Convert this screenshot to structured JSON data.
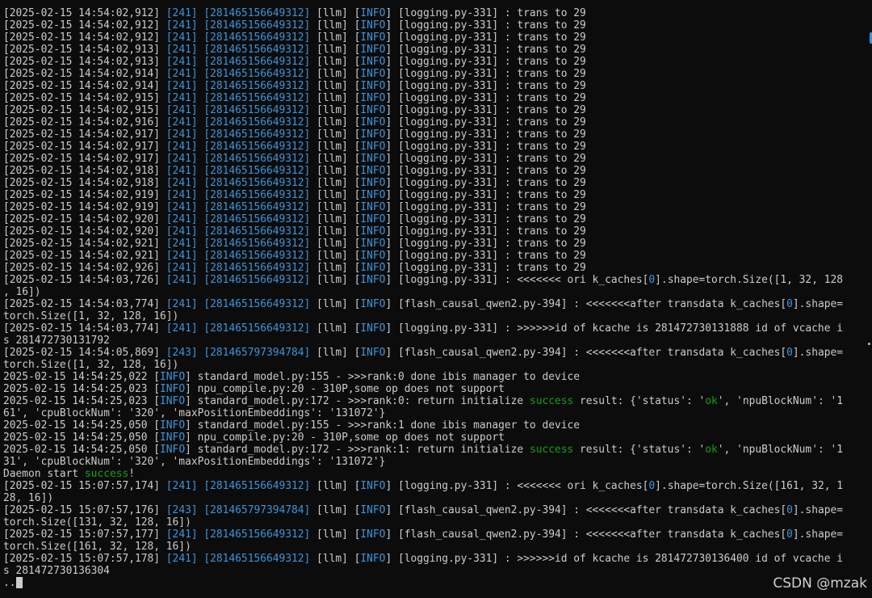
{
  "terminal": {
    "lines": [
      [
        [
          "[2025-02-15 14:54:02,912] ",
          "w"
        ],
        [
          "[241] [281465156649312]",
          "c"
        ],
        [
          " [llm] [",
          "w"
        ],
        [
          "INFO",
          "c"
        ],
        [
          "] [logging.py-331] : trans to 29",
          "w"
        ]
      ],
      [
        [
          "[2025-02-15 14:54:02,912] ",
          "w"
        ],
        [
          "[241] [281465156649312]",
          "c"
        ],
        [
          " [llm] [",
          "w"
        ],
        [
          "INFO",
          "c"
        ],
        [
          "] [logging.py-331] : trans to 29",
          "w"
        ]
      ],
      [
        [
          "[2025-02-15 14:54:02,912] ",
          "w"
        ],
        [
          "[241] [281465156649312]",
          "c"
        ],
        [
          " [llm] [",
          "w"
        ],
        [
          "INFO",
          "c"
        ],
        [
          "] [logging.py-331] : trans to 29",
          "w"
        ]
      ],
      [
        [
          "[2025-02-15 14:54:02,913] ",
          "w"
        ],
        [
          "[241] [281465156649312]",
          "c"
        ],
        [
          " [llm] [",
          "w"
        ],
        [
          "INFO",
          "c"
        ],
        [
          "] [logging.py-331] : trans to 29",
          "w"
        ]
      ],
      [
        [
          "[2025-02-15 14:54:02,913] ",
          "w"
        ],
        [
          "[241] [281465156649312]",
          "c"
        ],
        [
          " [llm] [",
          "w"
        ],
        [
          "INFO",
          "c"
        ],
        [
          "] [logging.py-331] : trans to 29",
          "w"
        ]
      ],
      [
        [
          "[2025-02-15 14:54:02,914] ",
          "w"
        ],
        [
          "[241] [281465156649312]",
          "c"
        ],
        [
          " [llm] [",
          "w"
        ],
        [
          "INFO",
          "c"
        ],
        [
          "] [logging.py-331] : trans to 29",
          "w"
        ]
      ],
      [
        [
          "[2025-02-15 14:54:02,914] ",
          "w"
        ],
        [
          "[241] [281465156649312]",
          "c"
        ],
        [
          " [llm] [",
          "w"
        ],
        [
          "INFO",
          "c"
        ],
        [
          "] [logging.py-331] : trans to 29",
          "w"
        ]
      ],
      [
        [
          "[2025-02-15 14:54:02,915] ",
          "w"
        ],
        [
          "[241] [281465156649312]",
          "c"
        ],
        [
          " [llm] [",
          "w"
        ],
        [
          "INFO",
          "c"
        ],
        [
          "] [logging.py-331] : trans to 29",
          "w"
        ]
      ],
      [
        [
          "[2025-02-15 14:54:02,915] ",
          "w"
        ],
        [
          "[241] [281465156649312]",
          "c"
        ],
        [
          " [llm] [",
          "w"
        ],
        [
          "INFO",
          "c"
        ],
        [
          "] [logging.py-331] : trans to 29",
          "w"
        ]
      ],
      [
        [
          "[2025-02-15 14:54:02,916] ",
          "w"
        ],
        [
          "[241] [281465156649312]",
          "c"
        ],
        [
          " [llm] [",
          "w"
        ],
        [
          "INFO",
          "c"
        ],
        [
          "] [logging.py-331] : trans to 29",
          "w"
        ]
      ],
      [
        [
          "[2025-02-15 14:54:02,917] ",
          "w"
        ],
        [
          "[241] [281465156649312]",
          "c"
        ],
        [
          " [llm] [",
          "w"
        ],
        [
          "INFO",
          "c"
        ],
        [
          "] [logging.py-331] : trans to 29",
          "w"
        ]
      ],
      [
        [
          "[2025-02-15 14:54:02,917] ",
          "w"
        ],
        [
          "[241] [281465156649312]",
          "c"
        ],
        [
          " [llm] [",
          "w"
        ],
        [
          "INFO",
          "c"
        ],
        [
          "] [logging.py-331] : trans to 29",
          "w"
        ]
      ],
      [
        [
          "[2025-02-15 14:54:02,917] ",
          "w"
        ],
        [
          "[241] [281465156649312]",
          "c"
        ],
        [
          " [llm] [",
          "w"
        ],
        [
          "INFO",
          "c"
        ],
        [
          "] [logging.py-331] : trans to 29",
          "w"
        ]
      ],
      [
        [
          "[2025-02-15 14:54:02,918] ",
          "w"
        ],
        [
          "[241] [281465156649312]",
          "c"
        ],
        [
          " [llm] [",
          "w"
        ],
        [
          "INFO",
          "c"
        ],
        [
          "] [logging.py-331] : trans to 29",
          "w"
        ]
      ],
      [
        [
          "[2025-02-15 14:54:02,918] ",
          "w"
        ],
        [
          "[241] [281465156649312]",
          "c"
        ],
        [
          " [llm] [",
          "w"
        ],
        [
          "INFO",
          "c"
        ],
        [
          "] [logging.py-331] : trans to 29",
          "w"
        ]
      ],
      [
        [
          "[2025-02-15 14:54:02,919] ",
          "w"
        ],
        [
          "[241] [281465156649312]",
          "c"
        ],
        [
          " [llm] [",
          "w"
        ],
        [
          "INFO",
          "c"
        ],
        [
          "] [logging.py-331] : trans to 29",
          "w"
        ]
      ],
      [
        [
          "[2025-02-15 14:54:02,919] ",
          "w"
        ],
        [
          "[241] [281465156649312]",
          "c"
        ],
        [
          " [llm] [",
          "w"
        ],
        [
          "INFO",
          "c"
        ],
        [
          "] [logging.py-331] : trans to 29",
          "w"
        ]
      ],
      [
        [
          "[2025-02-15 14:54:02,920] ",
          "w"
        ],
        [
          "[241] [281465156649312]",
          "c"
        ],
        [
          " [llm] [",
          "w"
        ],
        [
          "INFO",
          "c"
        ],
        [
          "] [logging.py-331] : trans to 29",
          "w"
        ]
      ],
      [
        [
          "[2025-02-15 14:54:02,920] ",
          "w"
        ],
        [
          "[241] [281465156649312]",
          "c"
        ],
        [
          " [llm] [",
          "w"
        ],
        [
          "INFO",
          "c"
        ],
        [
          "] [logging.py-331] : trans to 29",
          "w"
        ]
      ],
      [
        [
          "[2025-02-15 14:54:02,921] ",
          "w"
        ],
        [
          "[241] [281465156649312]",
          "c"
        ],
        [
          " [llm] [",
          "w"
        ],
        [
          "INFO",
          "c"
        ],
        [
          "] [logging.py-331] : trans to 29",
          "w"
        ]
      ],
      [
        [
          "[2025-02-15 14:54:02,921] ",
          "w"
        ],
        [
          "[241] [281465156649312]",
          "c"
        ],
        [
          " [llm] [",
          "w"
        ],
        [
          "INFO",
          "c"
        ],
        [
          "] [logging.py-331] : trans to 29",
          "w"
        ]
      ],
      [
        [
          "[2025-02-15 14:54:02,926] ",
          "w"
        ],
        [
          "[241] [281465156649312]",
          "c"
        ],
        [
          " [llm] [",
          "w"
        ],
        [
          "INFO",
          "c"
        ],
        [
          "] [logging.py-331] : trans to 29",
          "w"
        ]
      ],
      [
        [
          "[2025-02-15 14:54:03,726] ",
          "w"
        ],
        [
          "[241] [281465156649312]",
          "c"
        ],
        [
          " [llm] [",
          "w"
        ],
        [
          "INFO",
          "c"
        ],
        [
          "] [logging.py-331] : <<<<<<< ori k_caches[",
          "w"
        ],
        [
          "0",
          "c"
        ],
        [
          "].shape=torch.Size([1, 32, 128",
          "w"
        ]
      ],
      [
        [
          ", 16])",
          "w"
        ]
      ],
      [
        [
          "[2025-02-15 14:54:03,774] ",
          "w"
        ],
        [
          "[241] [281465156649312]",
          "c"
        ],
        [
          " [llm] [",
          "w"
        ],
        [
          "INFO",
          "c"
        ],
        [
          "] [flash_causal_qwen2.py-394] : <<<<<<<after transdata k_caches[",
          "w"
        ],
        [
          "0",
          "c"
        ],
        [
          "].shape=",
          "w"
        ]
      ],
      [
        [
          "torch.Size([1, 32, 128, 16])",
          "w"
        ]
      ],
      [
        [
          "[2025-02-15 14:54:03,774] ",
          "w"
        ],
        [
          "[241] [281465156649312]",
          "c"
        ],
        [
          " [llm] [",
          "w"
        ],
        [
          "INFO",
          "c"
        ],
        [
          "] [logging.py-331] : >>>>>>id of kcache is 281472730131888 id of vcache i",
          "w"
        ]
      ],
      [
        [
          "s 281472730131792",
          "w"
        ]
      ],
      [
        [
          "[2025-02-15 14:54:05,869] ",
          "w"
        ],
        [
          "[243] [281465797394784]",
          "c"
        ],
        [
          " [llm] [",
          "w"
        ],
        [
          "INFO",
          "c"
        ],
        [
          "] [flash_causal_qwen2.py-394] : <<<<<<<after transdata k_caches[",
          "w"
        ],
        [
          "0",
          "c"
        ],
        [
          "].shape=",
          "w"
        ]
      ],
      [
        [
          "torch.Size([1, 32, 128, 16])",
          "w"
        ]
      ],
      [
        [
          "2025-02-15 14:54:25,022 [",
          "w"
        ],
        [
          "INFO",
          "c"
        ],
        [
          "] standard_model.py:155 - >>>rank:0 done ibis manager to device",
          "w"
        ]
      ],
      [
        [
          "2025-02-15 14:54:25,023 [",
          "w"
        ],
        [
          "INFO",
          "c"
        ],
        [
          "] npu_compile.py:20 - 310P,some op does not support",
          "w"
        ]
      ],
      [
        [
          "2025-02-15 14:54:25,023 [",
          "w"
        ],
        [
          "INFO",
          "c"
        ],
        [
          "] standard_model.py:172 - >>>rank:0: return initialize ",
          "w"
        ],
        [
          "success",
          "g"
        ],
        [
          " result: {'status': '",
          "w"
        ],
        [
          "ok",
          "g"
        ],
        [
          "', 'npuBlockNum': '1",
          "w"
        ]
      ],
      [
        [
          "61', 'cpuBlockNum': '320', 'maxPositionEmbeddings': '131072'}",
          "w"
        ]
      ],
      [
        [
          "2025-02-15 14:54:25,050 [",
          "w"
        ],
        [
          "INFO",
          "c"
        ],
        [
          "] standard_model.py:155 - >>>rank:1 done ibis manager to device",
          "w"
        ]
      ],
      [
        [
          "2025-02-15 14:54:25,050 [",
          "w"
        ],
        [
          "INFO",
          "c"
        ],
        [
          "] npu_compile.py:20 - 310P,some op does not support",
          "w"
        ]
      ],
      [
        [
          "2025-02-15 14:54:25,050 [",
          "w"
        ],
        [
          "INFO",
          "c"
        ],
        [
          "] standard_model.py:172 - >>>rank:1: return initialize ",
          "w"
        ],
        [
          "success",
          "g"
        ],
        [
          " result: {'status': '",
          "w"
        ],
        [
          "ok",
          "g"
        ],
        [
          "', 'npuBlockNum': '1",
          "w"
        ]
      ],
      [
        [
          "31', 'cpuBlockNum': '320', 'maxPositionEmbeddings': '131072'}",
          "w"
        ]
      ],
      [
        [
          "Daemon start ",
          "w"
        ],
        [
          "success",
          "g"
        ],
        [
          "!",
          "w"
        ]
      ],
      [
        [
          "[2025-02-15 15:07:57,174] ",
          "w"
        ],
        [
          "[241] [281465156649312]",
          "c"
        ],
        [
          " [llm] [",
          "w"
        ],
        [
          "INFO",
          "c"
        ],
        [
          "] [logging.py-331] : <<<<<<< ori k_caches[",
          "w"
        ],
        [
          "0",
          "c"
        ],
        [
          "].shape=torch.Size([161, 32, 1",
          "w"
        ]
      ],
      [
        [
          "28, 16])",
          "w"
        ]
      ],
      [
        [
          "[2025-02-15 15:07:57,176] ",
          "w"
        ],
        [
          "[243] [281465797394784]",
          "c"
        ],
        [
          " [llm] [",
          "w"
        ],
        [
          "INFO",
          "c"
        ],
        [
          "] [flash_causal_qwen2.py-394] : <<<<<<<after transdata k_caches[",
          "w"
        ],
        [
          "0",
          "c"
        ],
        [
          "].shape=",
          "w"
        ]
      ],
      [
        [
          "torch.Size([131, 32, 128, 16])",
          "w"
        ]
      ],
      [
        [
          "[2025-02-15 15:07:57,177] ",
          "w"
        ],
        [
          "[241] [281465156649312]",
          "c"
        ],
        [
          " [llm] [",
          "w"
        ],
        [
          "INFO",
          "c"
        ],
        [
          "] [flash_causal_qwen2.py-394] : <<<<<<<after transdata k_caches[",
          "w"
        ],
        [
          "0",
          "c"
        ],
        [
          "].shape=",
          "w"
        ]
      ],
      [
        [
          "torch.Size([161, 32, 128, 16])",
          "w"
        ]
      ],
      [
        [
          "[2025-02-15 15:07:57,178] ",
          "w"
        ],
        [
          "[241] [281465156649312]",
          "c"
        ],
        [
          " [llm] [",
          "w"
        ],
        [
          "INFO",
          "c"
        ],
        [
          "] [logging.py-331] : >>>>>>id of kcache is 281472730136400 id of vcache i",
          "w"
        ]
      ],
      [
        [
          "s 281472730136304",
          "w"
        ]
      ]
    ],
    "prompt": "..",
    "colors": {
      "background": "#0c0c0c",
      "text": "#cccccc",
      "cyan": "#3a96dd",
      "green": "#13a10e"
    }
  },
  "watermark": "CSDN @mzak"
}
